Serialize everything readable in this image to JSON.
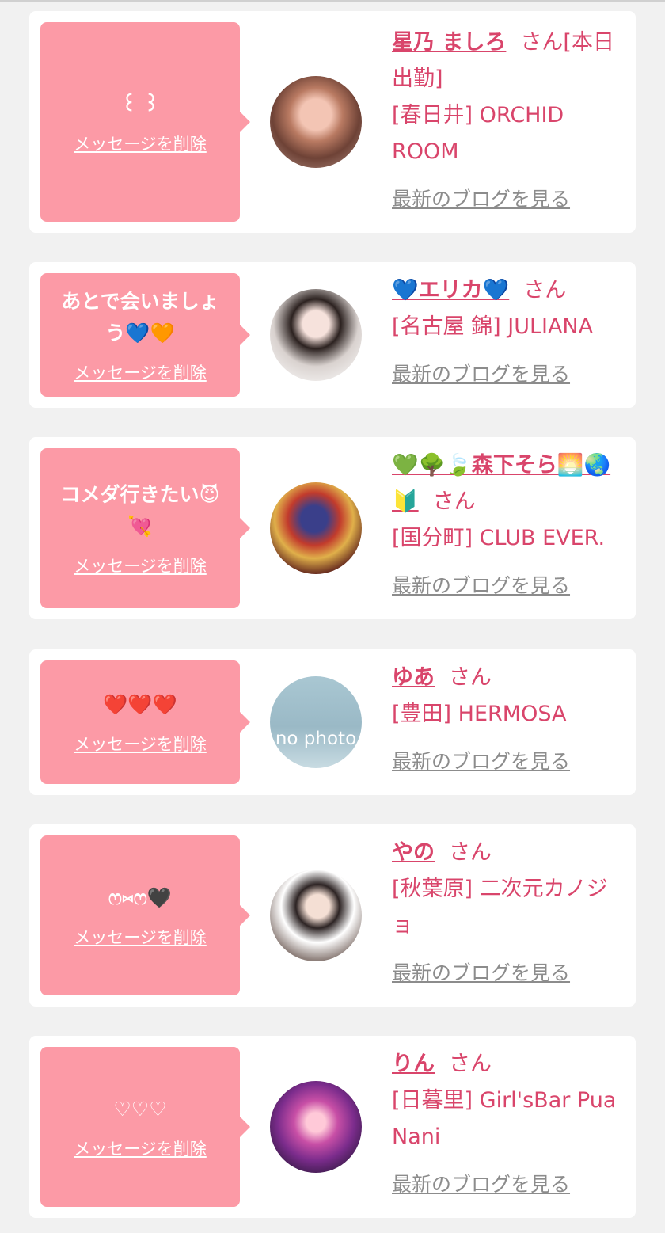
{
  "colors": {
    "accent": "#d9456b",
    "bubble": "#fc9aa6",
    "link_gray": "#8c8c8c"
  },
  "messages": [
    {
      "message": "꒰ ꒱",
      "delete_label": "メッセージを削除",
      "name": "星乃 ましろ",
      "san": "さん[本日出勤]",
      "shop": "[春日井] ORCHID ROOM",
      "blog_label": "最新のブログを見る"
    },
    {
      "message": "あとで会いましょう💙🧡",
      "delete_label": "メッセージを削除",
      "name": "💙エリカ💙",
      "san": "さん",
      "shop": "[名古屋 錦] JULIANA",
      "blog_label": "最新のブログを見る"
    },
    {
      "message": "コメダ行きたい😈💘",
      "delete_label": "メッセージを削除",
      "name": "💚🌳🍃森下そら🌅🌏🔰",
      "san": "さん",
      "shop": "[国分町] CLUB EVER.",
      "blog_label": "最新のブログを見る"
    },
    {
      "message": "❤️❤️❤️",
      "delete_label": "メッセージを削除",
      "name": "ゆあ",
      "san": "さん",
      "shop": "[豊田] HERMOSA",
      "blog_label": "最新のブログを見る",
      "no_photo_text": "no photo"
    },
    {
      "message": "ෆ⑅ෆ🖤",
      "delete_label": "メッセージを削除",
      "name": "やの",
      "san": "さん",
      "shop": "[秋葉原] 二次元カノジョ",
      "blog_label": "最新のブログを見る"
    },
    {
      "message": "♡♡♡",
      "delete_label": "メッセージを削除",
      "name": "りん",
      "san": "さん",
      "shop": "[日暮里] Girl'sBar Pua Nani",
      "blog_label": "最新のブログを見る"
    }
  ]
}
